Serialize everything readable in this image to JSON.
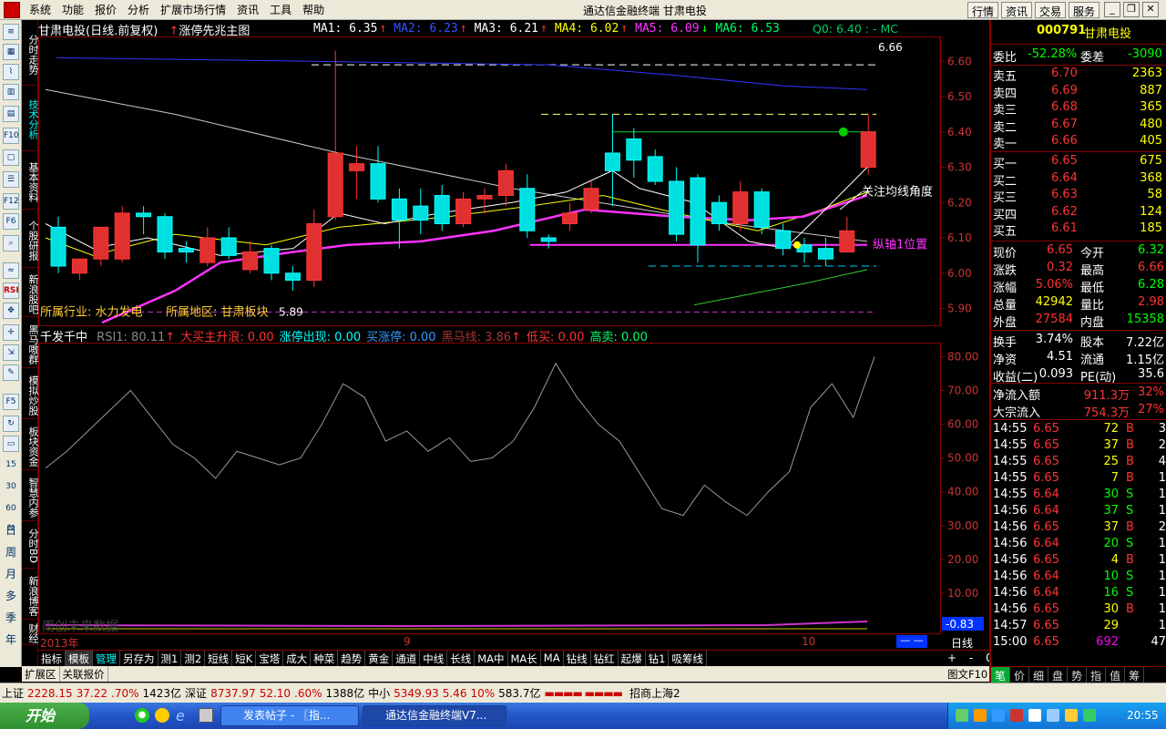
{
  "menu": {
    "items": [
      "系统",
      "功能",
      "报价",
      "分析",
      "扩展市场行情",
      "资讯",
      "工具",
      "帮助"
    ],
    "window_title": "通达信金融终端  甘肃电投",
    "right_buttons": [
      "行情",
      "资讯",
      "交易",
      "服务"
    ]
  },
  "left_tabs": [
    "分时走势",
    "技术分析",
    "基本资料",
    "个股研报",
    "新浪股吧",
    "黑马嗷群",
    "模拟炒股",
    "板块资金",
    "智慧内参",
    "分时BD",
    "新浪博客",
    "财经",
    "日",
    "周",
    "月",
    "多",
    "季",
    "年"
  ],
  "left_icon_labels": [
    "15",
    "30",
    "60",
    "N"
  ],
  "chart": {
    "stock_name": "甘肃电投",
    "period": "(日线.前复权)",
    "formula": "涨停先兆主图",
    "ma": [
      {
        "label": "MA1: 6.35",
        "color": "#ffffff",
        "arrow": "↑"
      },
      {
        "label": "MA2: 6.23",
        "color": "#3355ff",
        "arrow": "↑"
      },
      {
        "label": "MA3: 6.21",
        "color": "#ffffff",
        "arrow": "↑"
      },
      {
        "label": "MA4: 6.02",
        "color": "#ffff00",
        "arrow": "↑"
      },
      {
        "label": "MA5: 6.09",
        "color": "#ff33ff",
        "arrow": "↓"
      },
      {
        "label": "MA6: 6.53",
        "color": "#00ff66",
        "arrow": ""
      }
    ],
    "q0": "Q0: 6.40 : - MC",
    "high_label": "6.66",
    "low_label": "5.89",
    "note_ma_angle": "关注均线角度",
    "note_axis": "纵轴1位置",
    "industry_text": "所属行业: 水力发电",
    "region_text": "所属地区: 甘肃板块",
    "price_ticks": [
      "6.60",
      "6.50",
      "6.40",
      "6.30",
      "6.20",
      "6.10",
      "6.00",
      "5.90"
    ],
    "month_labels": [
      "2013年",
      "9",
      "10"
    ]
  },
  "chart_data": {
    "type": "candlestick",
    "x": [
      "d1",
      "d2",
      "d3",
      "d4",
      "d5",
      "d6",
      "d7",
      "d8",
      "d9",
      "d10",
      "d11",
      "d12",
      "d13",
      "d14",
      "d15",
      "d16",
      "d17",
      "d18",
      "d19",
      "d20",
      "d21",
      "d22",
      "d23",
      "d24",
      "d25",
      "d26",
      "d27",
      "d28",
      "d29",
      "d30",
      "d31",
      "d32",
      "d33",
      "d34",
      "d35",
      "d36",
      "d37",
      "d38",
      "d39"
    ],
    "open": [
      6.13,
      6.0,
      6.04,
      6.04,
      6.17,
      6.16,
      6.07,
      6.03,
      6.1,
      6.01,
      6.07,
      6.0,
      5.98,
      6.16,
      6.29,
      6.31,
      6.21,
      6.19,
      6.22,
      6.14,
      6.21,
      6.22,
      6.24,
      6.1,
      6.14,
      6.18,
      6.34,
      6.38,
      6.33,
      6.26,
      6.27,
      6.2,
      6.14,
      6.23,
      6.12,
      6.08,
      6.07,
      6.06,
      6.3
    ],
    "close": [
      6.02,
      6.04,
      6.13,
      6.17,
      6.16,
      6.06,
      6.06,
      6.1,
      6.05,
      6.06,
      6.0,
      5.98,
      6.14,
      6.34,
      6.31,
      6.21,
      6.15,
      6.15,
      6.14,
      6.21,
      6.22,
      6.29,
      6.12,
      6.09,
      6.17,
      6.24,
      6.29,
      6.32,
      6.26,
      6.11,
      6.08,
      6.14,
      6.23,
      6.13,
      6.07,
      6.06,
      6.04,
      6.12,
      6.4
    ],
    "high": [
      6.16,
      6.04,
      6.13,
      6.19,
      6.19,
      6.17,
      6.09,
      6.13,
      6.13,
      6.09,
      6.08,
      6.02,
      6.18,
      6.63,
      6.36,
      6.36,
      6.24,
      6.24,
      6.25,
      6.23,
      6.24,
      6.31,
      6.28,
      6.11,
      6.2,
      6.26,
      6.45,
      6.41,
      6.35,
      6.3,
      6.28,
      6.22,
      6.26,
      6.24,
      6.14,
      6.1,
      6.1,
      6.16,
      6.45
    ],
    "low": [
      6.0,
      5.98,
      6.02,
      6.03,
      6.11,
      6.04,
      6.03,
      6.02,
      6.04,
      6.0,
      5.98,
      5.95,
      5.96,
      6.15,
      6.21,
      6.2,
      6.07,
      6.11,
      6.12,
      6.13,
      6.17,
      6.19,
      6.1,
      6.07,
      6.12,
      6.17,
      6.19,
      6.27,
      6.25,
      6.09,
      6.03,
      6.12,
      6.12,
      6.11,
      6.05,
      6.03,
      6.02,
      6.06,
      6.28
    ],
    "ylim": [
      5.86,
      6.66
    ]
  },
  "indicator": {
    "name": "千发千中",
    "items": [
      {
        "label": "RSI1: 80.11",
        "color": "#888888",
        "arrow": "↑"
      },
      {
        "label": "大买主升浪: 0.00",
        "color": "#ff3333",
        "arrow": ""
      },
      {
        "label": "涨停出现: 0.00",
        "color": "#00ffff",
        "arrow": ""
      },
      {
        "label": "买涨停: 0.00",
        "color": "#3399ff",
        "arrow": ""
      },
      {
        "label": "黑马线: 3.86",
        "color": "#aa3333",
        "arrow": "↑"
      },
      {
        "label": "低买: 0.00",
        "color": "#ff3333",
        "arrow": ""
      },
      {
        "label": "高卖: 0.00",
        "color": "#00ff66",
        "arrow": ""
      }
    ],
    "rsi": [
      47,
      52,
      58,
      64,
      70,
      62,
      54,
      50,
      44,
      52,
      50,
      48,
      50,
      60,
      72,
      68,
      55,
      58,
      52,
      56,
      49,
      50,
      55,
      65,
      78,
      68,
      60,
      55,
      45,
      35,
      33,
      42,
      37,
      33,
      40,
      46,
      65,
      72,
      62,
      80
    ],
    "ticks": [
      "80.00",
      "70.00",
      "60.00",
      "50.00",
      "40.00",
      "30.00",
      "20.00",
      "10.00"
    ],
    "current": "-0.83",
    "watermark": "雨创未来数据"
  },
  "bottom_tabs": [
    "指标",
    "模板",
    "管理",
    "另存为",
    "测1",
    "测2",
    "短线",
    "短K",
    "宝塔",
    "成大",
    "种菜",
    "趋势",
    "黄金",
    "通道",
    "中线",
    "长线",
    "MA中",
    "MA长",
    "MA",
    "钻线",
    "钻红",
    "起爆",
    "钻1",
    "吸筹线"
  ],
  "sub_tabs": [
    "扩展区",
    "关联报价"
  ],
  "period_label": "日线",
  "zoom_controls": [
    "+",
    "-",
    "0"
  ],
  "graph_label": "图文F10",
  "right": {
    "code": "000791",
    "name": "甘肃电投",
    "weibi": {
      "label": "委比",
      "value": "-52.28%",
      "label2": "委差",
      "value2": "-3090"
    },
    "asks": [
      {
        "label": "卖五",
        "price": "6.70",
        "vol": "2363"
      },
      {
        "label": "卖四",
        "price": "6.69",
        "vol": "887"
      },
      {
        "label": "卖三",
        "price": "6.68",
        "vol": "365"
      },
      {
        "label": "卖二",
        "price": "6.67",
        "vol": "480"
      },
      {
        "label": "卖一",
        "price": "6.66",
        "vol": "405"
      }
    ],
    "bids": [
      {
        "label": "买一",
        "price": "6.65",
        "vol": "675"
      },
      {
        "label": "买二",
        "price": "6.64",
        "vol": "368"
      },
      {
        "label": "买三",
        "price": "6.63",
        "vol": "58"
      },
      {
        "label": "买四",
        "price": "6.62",
        "vol": "124"
      },
      {
        "label": "买五",
        "price": "6.61",
        "vol": "185"
      }
    ],
    "stats": [
      {
        "l1": "现价",
        "v1": "6.65",
        "c1": "red",
        "l2": "今开",
        "v2": "6.32",
        "c2": "green"
      },
      {
        "l1": "涨跌",
        "v1": "0.32",
        "c1": "red",
        "l2": "最高",
        "v2": "6.66",
        "c2": "red"
      },
      {
        "l1": "涨幅",
        "v1": "5.06%",
        "c1": "red",
        "l2": "最低",
        "v2": "6.28",
        "c2": "green"
      },
      {
        "l1": "总量",
        "v1": "42942",
        "c1": "yellow",
        "l2": "量比",
        "v2": "2.98",
        "c2": "red"
      },
      {
        "l1": "外盘",
        "v1": "27584",
        "c1": "red",
        "l2": "内盘",
        "v2": "15358",
        "c2": "green"
      }
    ],
    "stats2": [
      {
        "l1": "换手",
        "v1": "3.74%",
        "l2": "股本",
        "v2": "7.22亿"
      },
      {
        "l1": "净资",
        "v1": "4.51",
        "l2": "流通",
        "v2": "1.15亿"
      },
      {
        "l1": "收益(二)",
        "v1": "0.093",
        "l2": "PE(动)",
        "v2": "35.6"
      }
    ],
    "flows": [
      {
        "label": "净流入额",
        "value": "911.3万",
        "pct": "32%"
      },
      {
        "label": "大宗流入",
        "value": "754.3万",
        "pct": "27%"
      }
    ],
    "ticks": [
      {
        "t": "14:55",
        "p": "6.65",
        "v": "72",
        "s": "B",
        "n": "3",
        "pc": "red"
      },
      {
        "t": "14:55",
        "p": "6.65",
        "v": "37",
        "s": "B",
        "n": "2",
        "pc": "red"
      },
      {
        "t": "14:55",
        "p": "6.65",
        "v": "25",
        "s": "B",
        "n": "4",
        "pc": "red"
      },
      {
        "t": "14:55",
        "p": "6.65",
        "v": "7",
        "s": "B",
        "n": "1",
        "pc": "red"
      },
      {
        "t": "14:55",
        "p": "6.64",
        "v": "30",
        "s": "S",
        "n": "1",
        "pc": "red"
      },
      {
        "t": "14:56",
        "p": "6.64",
        "v": "37",
        "s": "S",
        "n": "1",
        "pc": "red"
      },
      {
        "t": "14:56",
        "p": "6.65",
        "v": "37",
        "s": "B",
        "n": "2",
        "pc": "red"
      },
      {
        "t": "14:56",
        "p": "6.64",
        "v": "20",
        "s": "S",
        "n": "1",
        "pc": "red"
      },
      {
        "t": "14:56",
        "p": "6.65",
        "v": "4",
        "s": "B",
        "n": "1",
        "pc": "red"
      },
      {
        "t": "14:56",
        "p": "6.64",
        "v": "10",
        "s": "S",
        "n": "1",
        "pc": "red"
      },
      {
        "t": "14:56",
        "p": "6.64",
        "v": "16",
        "s": "S",
        "n": "1",
        "pc": "red"
      },
      {
        "t": "14:56",
        "p": "6.65",
        "v": "30",
        "s": "B",
        "n": "1",
        "pc": "red"
      },
      {
        "t": "14:57",
        "p": "6.65",
        "v": "29",
        "s": "",
        "n": "1",
        "pc": "red"
      },
      {
        "t": "15:00",
        "p": "6.65",
        "v": "692",
        "s": "",
        "n": "47",
        "pc": "red"
      }
    ],
    "tabs": [
      "笔",
      "价",
      "细",
      "盘",
      "势",
      "指",
      "值",
      "筹"
    ]
  },
  "status": {
    "sh_label": "上证",
    "sh_value": "2228.15",
    "sh_change": "37.22",
    "sh_pct": ".70%",
    "sh_amount": "1423亿",
    "sz_label": "深证",
    "sz_value": "8737.97",
    "sz_change": "52.10",
    "sz_pct": ".60%",
    "sz_amount": "1388亿",
    "zx_label": "中小",
    "zx_value": "5349.93",
    "zx_change": "5.46",
    "zx_pct": "10%",
    "zx_amount": "583.7亿",
    "broker": "招商上海2"
  },
  "taskbar": {
    "start": "开始",
    "tasks": [
      "发表帖子 - 〖指...",
      "通达信金融终端V7..."
    ],
    "clock": "20:55"
  }
}
